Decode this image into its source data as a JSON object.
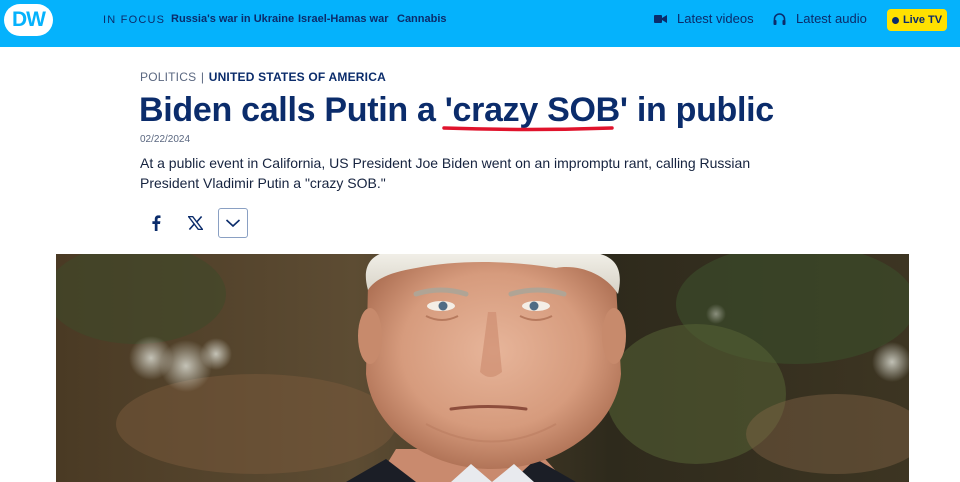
{
  "nav": {
    "logo": "DW",
    "in_focus": "IN FOCUS",
    "links": [
      "Russia's war in Ukraine",
      "Israel-Hamas war",
      "Cannabis"
    ],
    "latest_videos": "Latest videos",
    "latest_audio": "Latest audio",
    "live_tv": "Live TV"
  },
  "article": {
    "category": "POLITICS",
    "separator": "|",
    "country": "UNITED STATES OF AMERICA",
    "headline": "Biden calls Putin a 'crazy SOB' in public",
    "date": "02/22/2024",
    "lead": "At a public event in California, US President Joe Biden went on an impromptu rant, calling Russian President Vladimir Putin a \"crazy SOB.\"",
    "highlight_color": "#e0132c"
  },
  "share": {
    "facebook": "f-icon",
    "x": "x-icon",
    "more": "chevron-down-icon"
  },
  "colors": {
    "brand_blue": "#05b2fc",
    "navy": "#0b2c6b",
    "live_yellow": "#ffe100"
  }
}
